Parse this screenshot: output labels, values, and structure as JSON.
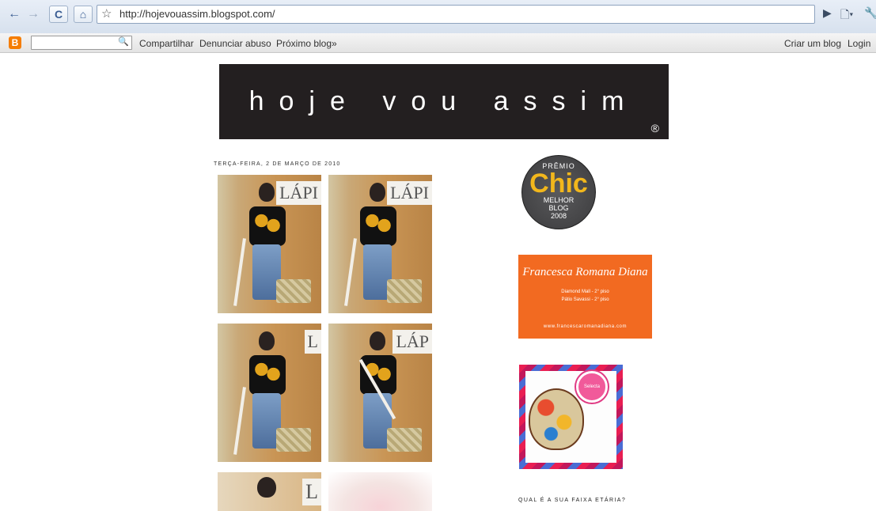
{
  "browser": {
    "url": "http://hojevouassim.blogspot.com/",
    "back": "←",
    "forward": "→",
    "reload": "C",
    "home": "⌂",
    "star": "☆",
    "go": "▶",
    "page_menu": "🗋▾",
    "tools": "🔧"
  },
  "navbar": {
    "logo": "B",
    "search_placeholder": "",
    "search_icon": "🔍",
    "share": "Compartilhar",
    "report": "Denunciar abuso",
    "next": "Próximo blog»",
    "create": "Criar um blog",
    "login": "Login"
  },
  "blog": {
    "title": "hoje vou assim",
    "registered": "®",
    "post_date": "TERÇA-FEIRA, 2 DE MARÇO DE 2010",
    "photo_sign_a": "LÁPI",
    "photo_sign_b": "LÁPI",
    "photo_sign_c": "L",
    "photo_sign_d": "LÁP",
    "photo_sign_e": "L"
  },
  "sidebar": {
    "badge": {
      "premio": "PRÊMIO",
      "chic": "Chic",
      "melhor": "MELHOR",
      "blog": "BLOG",
      "year": "2008"
    },
    "francesca": {
      "brand": "Francesca Romana Diana",
      "line1": "Diamond Mall - 2° piso",
      "line2": "Pátio Savassi - 2° piso",
      "url": "www.francescaromanadiana.com"
    },
    "bag_seal": "Selecta",
    "poll_title": "QUAL É A SUA FAIXA ETÁRIA?"
  }
}
